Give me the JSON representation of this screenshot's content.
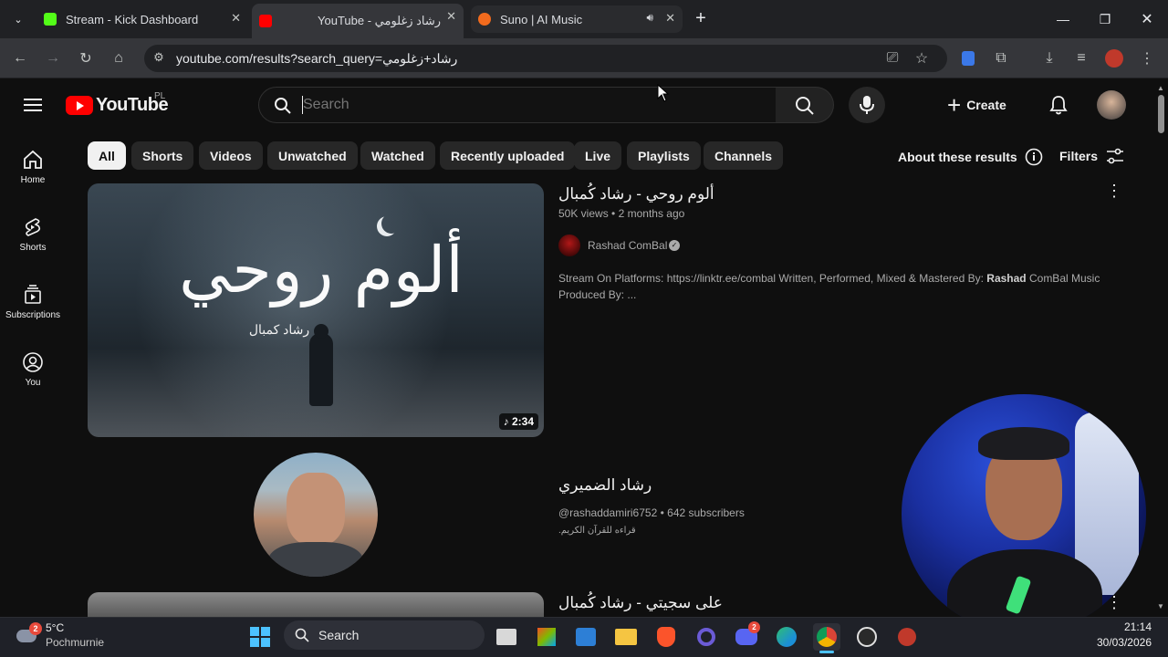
{
  "browser": {
    "tabs": [
      {
        "title": "Stream - Kick Dashboard",
        "favicon_color": "#53fc18"
      },
      {
        "title": "YouTube - رشاد زغلومي",
        "favicon_color": "#ff0000"
      },
      {
        "title": "Suno | AI Music",
        "favicon_color": "#f26b1d"
      }
    ],
    "url": "youtube.com/results?search_query=رشاد+زغلومي"
  },
  "youtube": {
    "logo_text": "YouTube",
    "country_code": "PL",
    "search_placeholder": "Search",
    "create_label": "Create",
    "chips": [
      "All",
      "Shorts",
      "Videos",
      "Unwatched",
      "Watched",
      "Recently uploaded",
      "Live",
      "Playlists",
      "Channels"
    ],
    "about_results": "About these results",
    "filters": "Filters",
    "sidebar": [
      "Home",
      "Shorts",
      "Subscriptions",
      "You"
    ],
    "results": [
      {
        "title": "ألوم روحي - رشاد كُمبال",
        "views": "50K views",
        "age": "2 months ago",
        "channel": "Rashad ComBal",
        "description": "Stream On Platforms: https://linktr.ee/combal Written, Performed, Mixed & Mastered By: Rashad ComBal Music Produced By: ...",
        "description_bold": "Rashad",
        "duration": "2:34",
        "thumb_title": "ألوم روحي",
        "thumb_sub": "رشاد كمبال"
      },
      {
        "title": "رشاد الضميري",
        "handle": "@rashaddamiri6752",
        "subscribers": "642 subscribers",
        "description": "قراءه للقرآن الكريم."
      },
      {
        "title": "على سجيتي - رشاد كُمبال"
      }
    ]
  },
  "taskbar": {
    "weather_temp": "5°C",
    "weather_desc": "Pochmurnie",
    "weather_badge": "2",
    "search_label": "Search",
    "discord_badge": "2",
    "time": "21:14",
    "date": "30/03/2026"
  }
}
